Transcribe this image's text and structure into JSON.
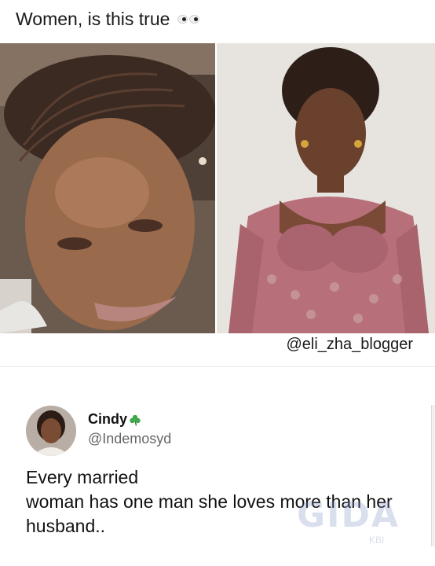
{
  "post": {
    "caption": "Women, is this true",
    "caption_emoji": "eyes"
  },
  "photos": {
    "left_alt": "selfie",
    "right_alt": "portrait",
    "credit": "@eli_zha_blogger"
  },
  "tweet": {
    "name": "Cindy",
    "name_emoji": "shamrock-icon",
    "handle": "@Indemosyd",
    "text_lines": [
      "Every married",
      "woman has one man she loves more than her",
      "husband.."
    ]
  },
  "watermark": {
    "text": "GIDA",
    "sub": "KBI"
  },
  "colors": {
    "dress": "#b7707a",
    "shamrock": "#3fa94a",
    "handle_gray": "#666666"
  }
}
